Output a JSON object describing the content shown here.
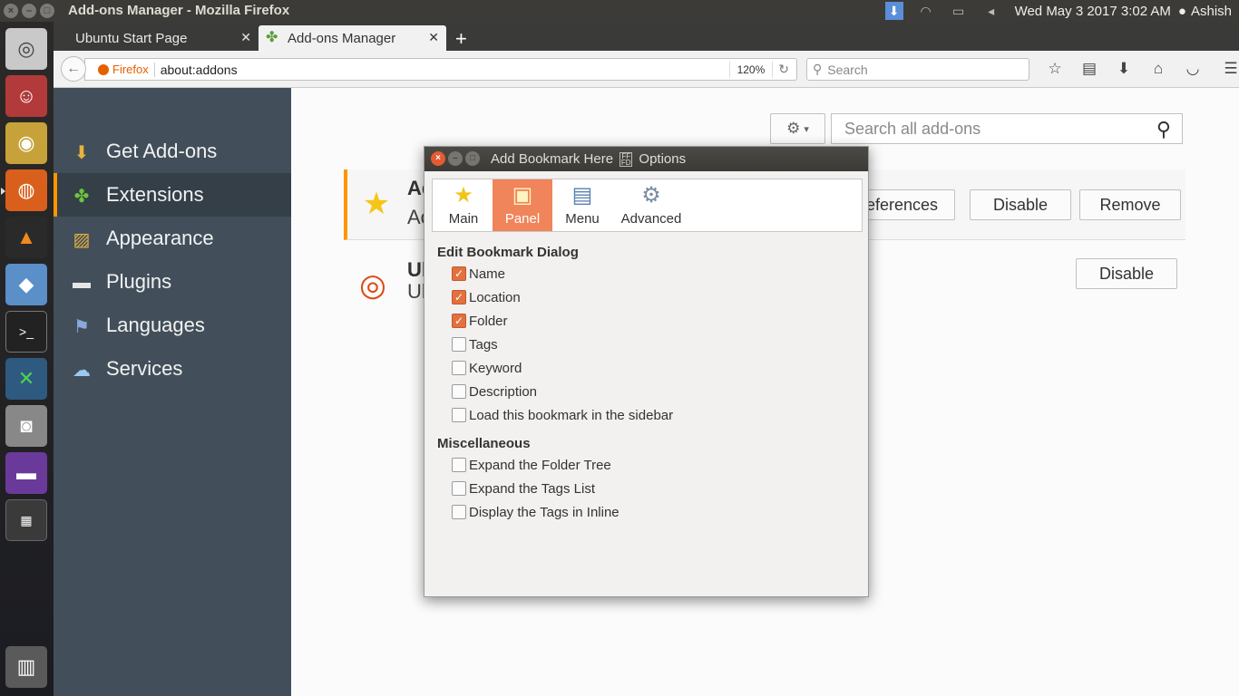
{
  "top_panel": {
    "window_title": "Add-ons Manager - Mozilla Firefox",
    "clock": "Wed May 3 2017  3:02 AM",
    "user": "Ashish"
  },
  "tabs": [
    {
      "label": "Ubuntu Start Page"
    },
    {
      "label": "Add-ons Manager"
    }
  ],
  "navbar": {
    "identity": "Firefox",
    "url": "about:addons",
    "zoom": "120%",
    "search_placeholder": "Search"
  },
  "sidebar": {
    "items": [
      {
        "label": "Get Add-ons",
        "icon": "get-addons-icon"
      },
      {
        "label": "Extensions",
        "icon": "puzzle-icon",
        "selected": true
      },
      {
        "label": "Appearance",
        "icon": "brush-icon"
      },
      {
        "label": "Plugins",
        "icon": "plugin-icon"
      },
      {
        "label": "Languages",
        "icon": "flag-icon"
      },
      {
        "label": "Services",
        "icon": "cloud-icon"
      }
    ]
  },
  "addons_toolbar": {
    "search_placeholder": "Search all add-ons"
  },
  "addons": [
    {
      "name_partial": "Ad",
      "desc_partial": "Ac",
      "buttons": [
        "references",
        "Disable",
        "Remove"
      ]
    },
    {
      "name_partial": "Ul",
      "desc_partial": "Ul",
      "buttons": [
        "Disable"
      ]
    }
  ],
  "dialog": {
    "title": "Add Bookmark Here",
    "title_suffix": "Options",
    "toolbar": [
      {
        "label": "Main"
      },
      {
        "label": "Panel",
        "active": true
      },
      {
        "label": "Menu"
      },
      {
        "label": "Advanced"
      }
    ],
    "section1_title": "Edit Bookmark Dialog",
    "section1_items": [
      {
        "label": "Name",
        "checked": true
      },
      {
        "label": "Location",
        "checked": true
      },
      {
        "label": "Folder",
        "checked": true
      },
      {
        "label": "Tags",
        "checked": false
      },
      {
        "label": "Keyword",
        "checked": false
      },
      {
        "label": "Description",
        "checked": false
      },
      {
        "label": "Load this bookmark in the sidebar",
        "checked": false
      }
    ],
    "section2_title": "Miscellaneous",
    "section2_items": [
      {
        "label": "Expand the Folder Tree",
        "checked": false
      },
      {
        "label": "Expand the Tags List",
        "checked": false
      },
      {
        "label": "Display the Tags in Inline",
        "checked": false
      }
    ]
  },
  "colors": {
    "accent": "#ff9500",
    "dialog_active": "#f0845a",
    "checkbox_on": "#e2713f",
    "sidebar_bg": "#424f5a"
  }
}
